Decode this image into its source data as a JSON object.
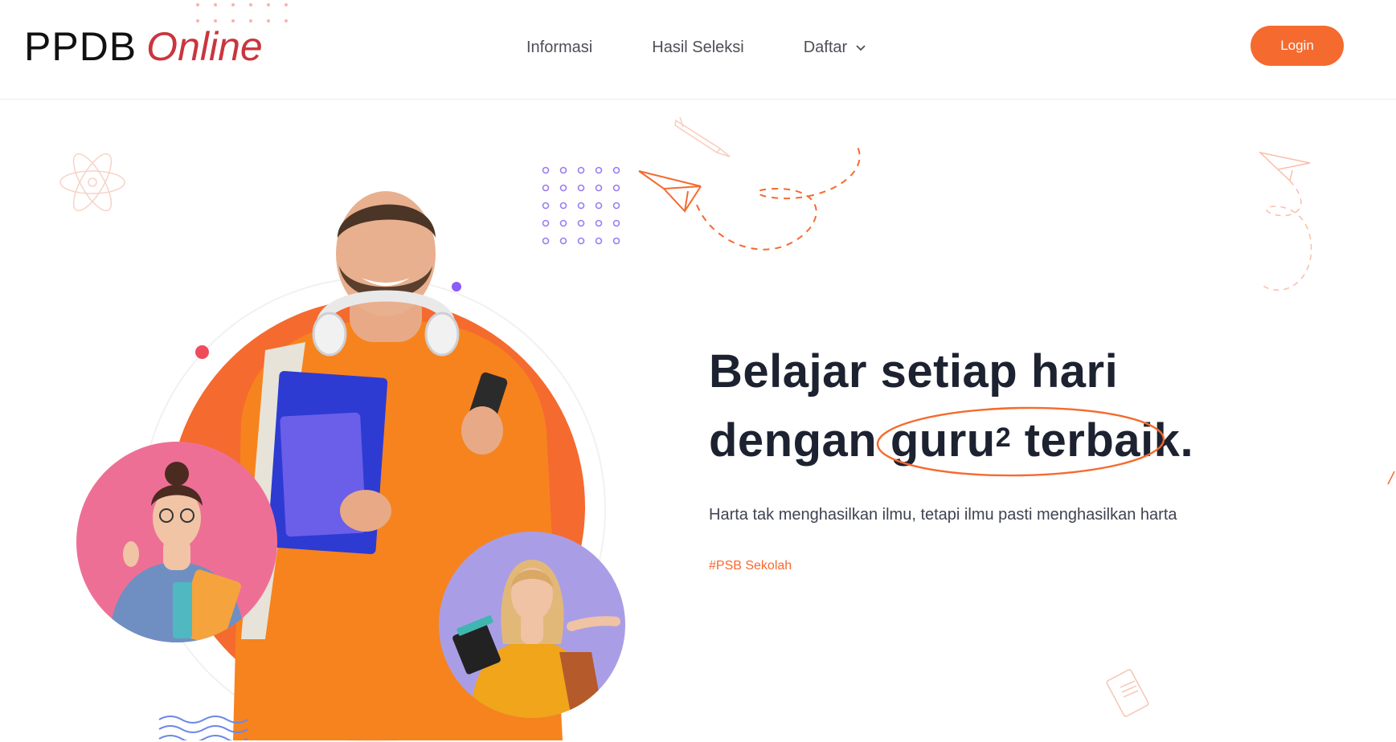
{
  "header": {
    "logo_main": "PPDB",
    "logo_accent": "Online",
    "nav": [
      {
        "label": "Informasi"
      },
      {
        "label": "Hasil Seleksi"
      },
      {
        "label": "Daftar",
        "icon": "chevron-down-icon"
      }
    ],
    "login_label": "Login"
  },
  "hero": {
    "headline_line1": "Belajar setiap hari",
    "headline_prefix": "dengan ",
    "headline_highlight": "guru",
    "headline_superscript": "2",
    "headline_suffix": " terbaik.",
    "subtitle": "Harta tak menghasilkan ilmu, tetapi ilmu pasti menghasilkan harta",
    "tag": "#PSB Sekolah"
  },
  "colors": {
    "accent": "#f56a2f",
    "logo_accent": "#c9363e",
    "headline": "#1d2230",
    "pink": "#ee6f96",
    "lavender": "#a99ee6",
    "purple_dot": "#8b5cf6"
  }
}
